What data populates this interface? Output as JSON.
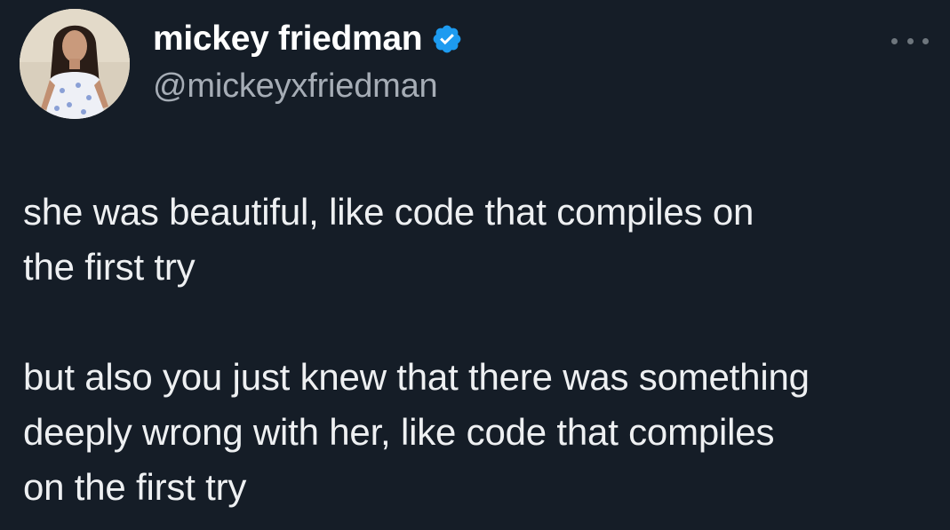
{
  "author": {
    "display_name": "mickey friedman",
    "handle": "@mickeyxfriedman",
    "verified": true,
    "avatar_icon": "profile-photo"
  },
  "menu": {
    "icon": "more-horizontal-icon"
  },
  "tweet": {
    "paragraphs": [
      "she was beautiful, like code that compiles on\nthe first try",
      "but also you just knew that there was something\ndeeply wrong with her, like code that compiles\non the first try"
    ]
  },
  "colors": {
    "background": "#151d27",
    "verified_badge": "#1d9bf0",
    "handle_text": "#a6adb6"
  }
}
